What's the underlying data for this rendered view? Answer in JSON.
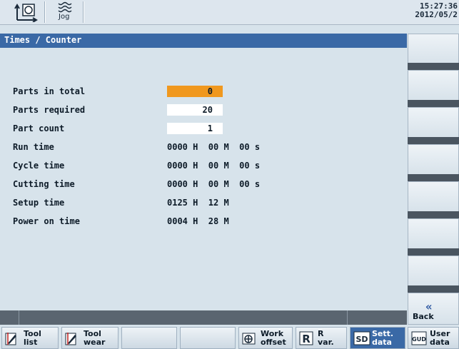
{
  "header": {
    "mode_icon": "reference-point-icon",
    "jog_icon": "jog-icon",
    "jog_label": "Jog",
    "time": "15:27:36",
    "date": "2012/05/2"
  },
  "window": {
    "title": "Times / Counter"
  },
  "counters": [
    {
      "label": "Parts in total",
      "value": "0"
    },
    {
      "label": "Parts required",
      "value": "20"
    },
    {
      "label": "Part count",
      "value": "1"
    }
  ],
  "times": [
    {
      "label": "Run time",
      "value": "0000 H  00 M  00 s"
    },
    {
      "label": "Cycle time",
      "value": "0000 H  00 M  00 s"
    },
    {
      "label": "Cutting time",
      "value": "0000 H  00 M  00 s"
    },
    {
      "label": "Setup time",
      "value": "0125 H  12 M"
    },
    {
      "label": "Power on time",
      "value": "0004 H  28 M"
    }
  ],
  "softkeys_right": {
    "back_label": "Back",
    "back_icon": "double-chevron-left-icon"
  },
  "softkeys_bottom": [
    {
      "line1": "Tool",
      "line2": "list",
      "icon": "tool-list-icon"
    },
    {
      "line1": "Tool",
      "line2": "wear",
      "icon": "tool-wear-icon"
    },
    {
      "line1": "",
      "line2": "",
      "icon": ""
    },
    {
      "line1": "",
      "line2": "",
      "icon": ""
    },
    {
      "line1": "Work",
      "line2": "offset",
      "icon": "work-offset-icon"
    },
    {
      "line1": "R",
      "line2": "var.",
      "icon": "r-variable-icon"
    },
    {
      "line1": "Sett.",
      "line2": "data",
      "icon": "sd-icon"
    },
    {
      "line1": "User",
      "line2": "data",
      "icon": "gud-icon"
    }
  ],
  "colors": {
    "title_bar": "#3a69a6",
    "active_field": "#f0981e",
    "background": "#d7e3eb"
  }
}
